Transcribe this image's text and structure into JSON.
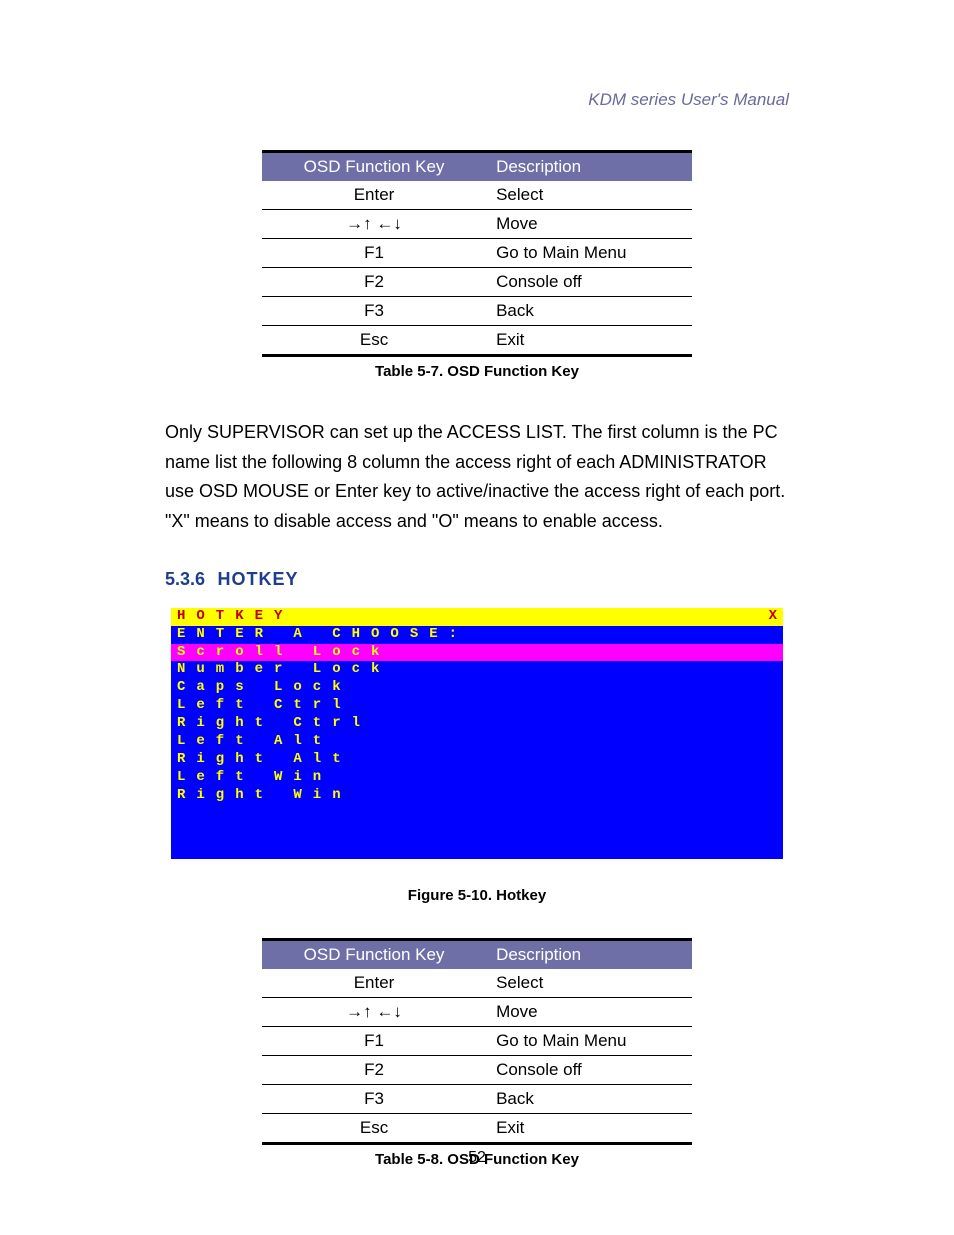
{
  "header": {
    "right": "KDM series User's Manual"
  },
  "table1": {
    "headers": [
      "OSD Function Key",
      "Description"
    ],
    "rows": [
      {
        "key": "Enter",
        "desc": "Select"
      },
      {
        "key": "→↑ ←↓",
        "desc": "Move"
      },
      {
        "key": "F1",
        "desc": "Go to Main Menu"
      },
      {
        "key": "F2",
        "desc": "Console off"
      },
      {
        "key": "F3",
        "desc": "Back"
      },
      {
        "key": "Esc",
        "desc": "Exit"
      }
    ],
    "caption": "Table 5-7. OSD Function Key"
  },
  "paragraph": "Only SUPERVISOR can set up the ACCESS LIST. The first column is the PC name list the following 8 column the access right of each ADMINISTRATOR use OSD MOUSE or Enter key to active/inactive the access right of each port. \"X\" means to disable access and \"O\" means to enable access.",
  "section": {
    "number": "5.3.6",
    "title": "HOTKEY"
  },
  "hotkey": {
    "title": "HOTKEY",
    "close_x": "X",
    "prompt": "ENTER A CHOOSE:",
    "selected": "Scroll Lock",
    "items": [
      "Number Lock",
      "Caps Lock",
      "Left Ctrl",
      "Right Ctrl",
      "Left Alt",
      "Right Alt",
      "Left Win",
      "Right Win"
    ],
    "figure_caption": "Figure 5-10. Hotkey"
  },
  "table2": {
    "headers": [
      "OSD Function Key",
      "Description"
    ],
    "rows": [
      {
        "key": "Enter",
        "desc": "Select"
      },
      {
        "key": "→↑ ←↓",
        "desc": "Move"
      },
      {
        "key": "F1",
        "desc": "Go to Main Menu"
      },
      {
        "key": "F2",
        "desc": "Console off"
      },
      {
        "key": "F3",
        "desc": "Back"
      },
      {
        "key": "Esc",
        "desc": "Exit"
      }
    ],
    "caption": "Table 5-8. OSD Function Key"
  },
  "page_number": "52"
}
